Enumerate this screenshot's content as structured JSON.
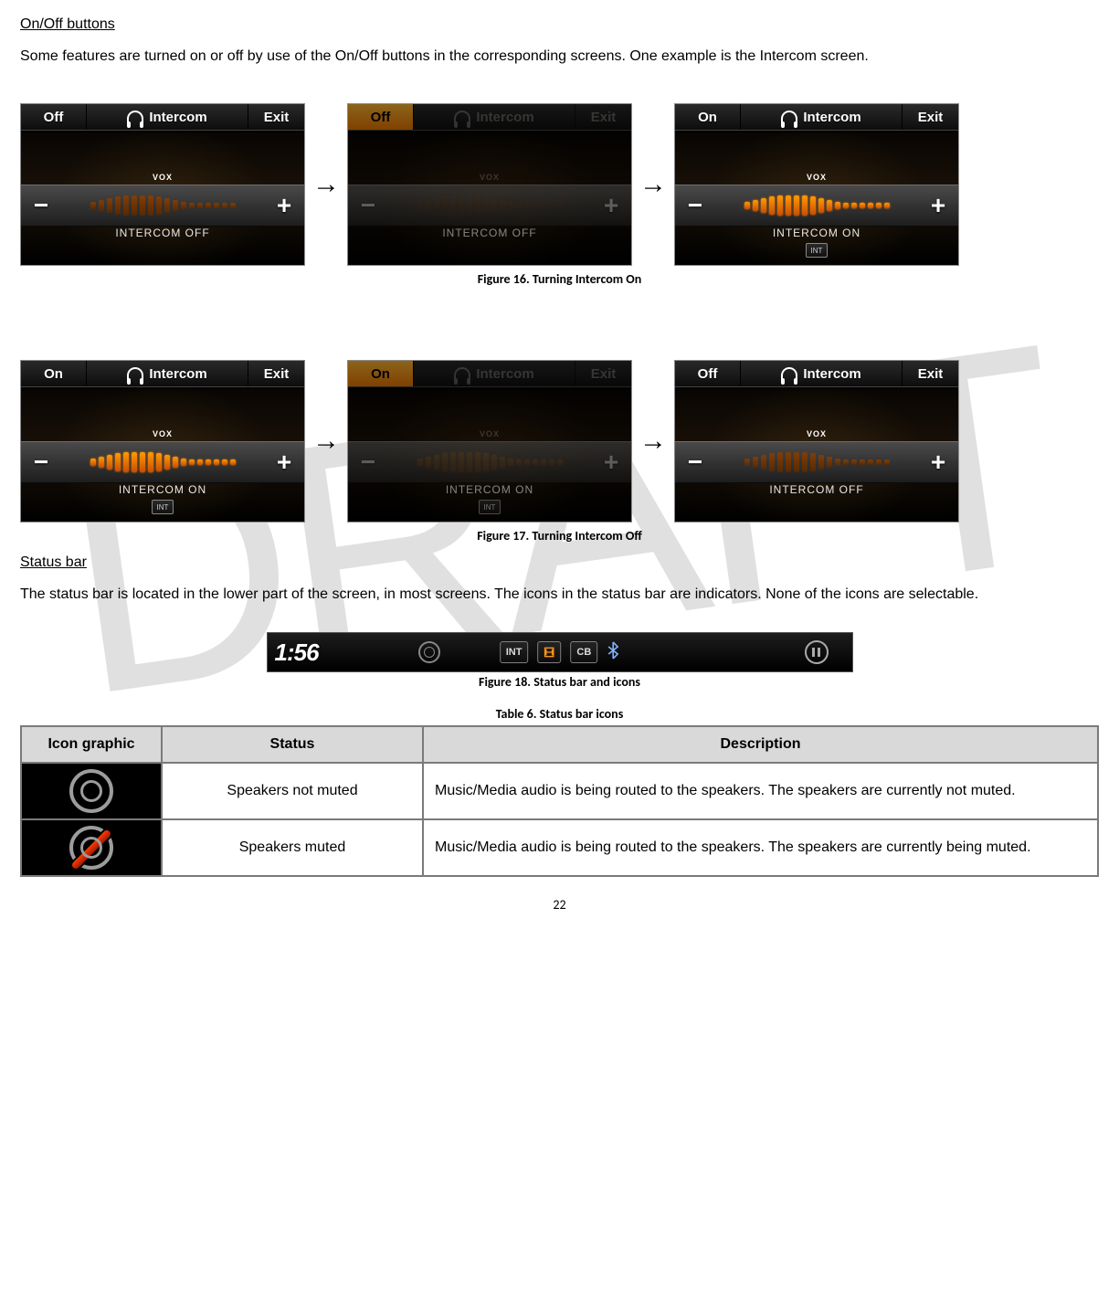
{
  "watermark": "DRAFT",
  "sections": {
    "onoff_heading": "On/Off buttons",
    "onoff_para": "Some features are turned on or off by use of the On/Off buttons in the corresponding screens. One example is the Intercom screen.",
    "status_heading": "Status bar",
    "status_para": "The status bar is located in the lower part of the screen, in most screens. The icons in the status bar are indicators. None of the icons are selectable."
  },
  "figures": {
    "f16": "Figure 16. Turning Intercom On",
    "f17": "Figure 17. Turning Intercom Off",
    "f18": "Figure 18. Status bar and icons"
  },
  "tables": {
    "t6_caption": "Table 6. Status bar icons",
    "t6_headers": {
      "icon": "Icon graphic",
      "status": "Status",
      "desc": "Description"
    },
    "t6_rows": [
      {
        "status": "Speakers not muted",
        "desc": "Music/Media audio is being routed to the speakers. The speakers are currently not muted."
      },
      {
        "status": "Speakers muted",
        "desc": "Music/Media audio is being routed to the speakers. The speakers are currently being muted."
      }
    ]
  },
  "intercom_header": {
    "intercom": "Intercom",
    "exit": "Exit",
    "vox": "VOX"
  },
  "seq_on": [
    {
      "left": "Off",
      "selected": false,
      "dim": false,
      "state": "INTERCOM OFF",
      "ticks_on": false,
      "mini": false
    },
    {
      "left": "Off",
      "selected": true,
      "dim": true,
      "state": "INTERCOM OFF",
      "ticks_on": false,
      "mini": false
    },
    {
      "left": "On",
      "selected": false,
      "dim": false,
      "state": "INTERCOM ON",
      "ticks_on": true,
      "mini": true
    }
  ],
  "seq_off": [
    {
      "left": "On",
      "selected": false,
      "dim": false,
      "state": "INTERCOM ON",
      "ticks_on": true,
      "mini": true
    },
    {
      "left": "On",
      "selected": true,
      "dim": true,
      "state": "INTERCOM ON",
      "ticks_on": true,
      "mini": true
    },
    {
      "left": "Off",
      "selected": false,
      "dim": false,
      "state": "INTERCOM OFF",
      "ticks_on": false,
      "mini": false
    }
  ],
  "status_bar": {
    "time": "1:56",
    "chips": {
      "int": "INT",
      "hd": "⧈",
      "cb": "CB"
    }
  },
  "page_number": "22"
}
